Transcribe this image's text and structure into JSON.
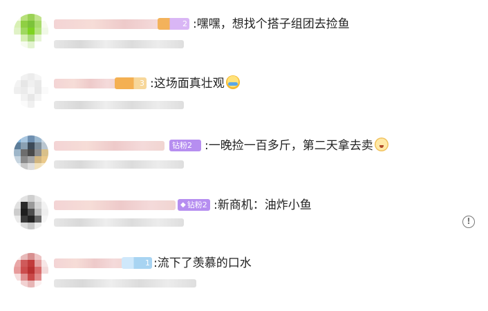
{
  "comments": [
    {
      "text": ":嘿嘿，想找个搭子组团去捡鱼",
      "level": "2",
      "level_color": "#c9a6ef",
      "avatar_colors": [
        "#f4fbe4",
        "#b7e07a",
        "#9ad255",
        "#c2e48d",
        "#ffffff",
        "#d8f0b4",
        "#8fcf43",
        "#7cc33a",
        "#a9dc6c",
        "#f7fbee",
        "#e0f2c6",
        "#9fd85f",
        "#7ed321",
        "#b5e37e",
        "#f0f8e6",
        "#ffffff",
        "#d4ee b0",
        "#a9d97a",
        "#e7f5d6",
        "#ffffff",
        "#ffffff",
        "#f6fbef",
        "#e2f3cf",
        "#ffffff",
        "#ffffff"
      ],
      "emoji": ""
    },
    {
      "text": ":这场面真壮观",
      "level": "3",
      "level_color": "#f7c778",
      "avatar_colors": [
        "#ffffff",
        "#f1f1f1",
        "#ececec",
        "#f5f5f5",
        "#ffffff",
        "#f3f3f3",
        "#e6e6e6",
        "#f0f0f0",
        "#e9e9e9",
        "#ffffff",
        "#efefef",
        "#ebebeb",
        "#f6f6f6",
        "#e8e8e8",
        "#fafafa",
        "#ffffff",
        "#f2f2f2",
        "#e7e7e7",
        "#f4f4f4",
        "#ffffff",
        "#ffffff",
        "#fbfbfb",
        "#f0f0f0",
        "#ffffff",
        "#ffffff"
      ],
      "emoji": "cry"
    },
    {
      "text": ":一晚捡一百多斤，第二天拿去卖",
      "fan_label": "钻粉2",
      "avatar_colors": [
        "#7fb1d8",
        "#a8c6e0",
        "#6e8fb0",
        "#9bb8cf",
        "#c9d8e4",
        "#5d7d99",
        "#8aa0b2",
        "#3c4a58",
        "#7d8d9a",
        "#b9c6d0",
        "#9eb6c9",
        "#6d6d6d",
        "#4a4a4a",
        "#8d8d8d",
        "#d9c08a",
        "#c6d4df",
        "#8a8a8a",
        "#a5a5a5",
        "#d2b680",
        "#eac98a",
        "#e7eef3",
        "#c9c9c9",
        "#dedede",
        "#f1e1bb",
        "#f7e9c9"
      ],
      "emoji": "laugh"
    },
    {
      "text": ":新商机：油炸小鱼",
      "fan_label": "钻粉2",
      "avatar_colors": [
        "#f4f4f4",
        "#e2e2e2",
        "#cfcfcf",
        "#e6e6e6",
        "#fafafa",
        "#e0e0e0",
        "#2b2b2b",
        "#9a9a9a",
        "#d5d5d5",
        "#f2f2f2",
        "#cccccc",
        "#1e1e1e",
        "#4d4d4d",
        "#bdbdbd",
        "#eeeeee",
        "#e9e9e9",
        "#3a3a3a",
        "#222222",
        "#6a6a6a",
        "#f5f5f5",
        "#fbfbfb",
        "#dcdcdc",
        "#c8c8c8",
        "#ededed",
        "#ffffff"
      ],
      "emoji": ""
    },
    {
      "text": ":流下了羡慕的口水",
      "level": "1",
      "level_color": "#a8d4f2",
      "avatar_colors": [
        "#fbeeee",
        "#e7b9b9",
        "#d88f8f",
        "#eec4c4",
        "#ffffff",
        "#e9a7a7",
        "#cf5a5a",
        "#c23b3b",
        "#e5a1a1",
        "#f7e6e6",
        "#e79b9b",
        "#cc4d4d",
        "#b83030",
        "#d86d6d",
        "#f3dada",
        "#f6dede",
        "#df8f8f",
        "#c94848",
        "#e08a8a",
        "#ffffff",
        "#ffffff",
        "#f2d2d2",
        "#e7b5b5",
        "#fbefef",
        "#ffffff"
      ],
      "emoji": ""
    }
  ],
  "report_icon": "exclamation-circle-icon"
}
